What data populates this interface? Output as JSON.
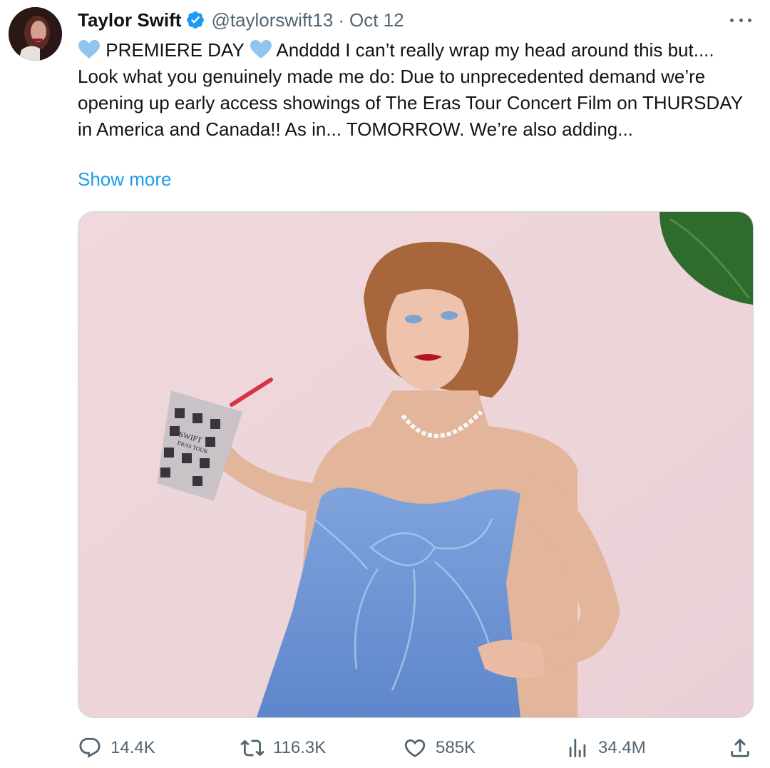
{
  "author": {
    "name": "Taylor Swift",
    "handle": "@taylorswift13",
    "separator": "·",
    "date": "Oct 12"
  },
  "icons": {
    "verified": "verified-badge-icon",
    "heart_emoji": "light-blue-heart-icon",
    "more": "more-horizontal-icon",
    "reply": "reply-icon",
    "retweet": "retweet-icon",
    "like": "like-heart-icon",
    "views": "views-bar-chart-icon",
    "share": "share-upload-icon"
  },
  "colors": {
    "link": "#1d9bf0",
    "verified": "#1d9bf0",
    "heart_emoji": "#8fc5ef",
    "muted": "#536471"
  },
  "tweet": {
    "premiere": "PREMIERE DAY",
    "line1_rest": "Andddd I can’t really wrap my head around this",
    "body": "but.... Look what you genuinely made me do: Due to unprecedented demand we’re opening up early access showings of The Eras Tour Concert Film on THURSDAY in America and Canada!! As in... TOMORROW. We’re also adding...",
    "show_more": "Show more"
  },
  "media": {
    "cup_text_line1": "SWIFT",
    "cup_text_line2": "ERAS TOUR"
  },
  "actions": {
    "replies": "14.4K",
    "retweets": "116.3K",
    "likes": "585K",
    "views": "34.4M"
  }
}
